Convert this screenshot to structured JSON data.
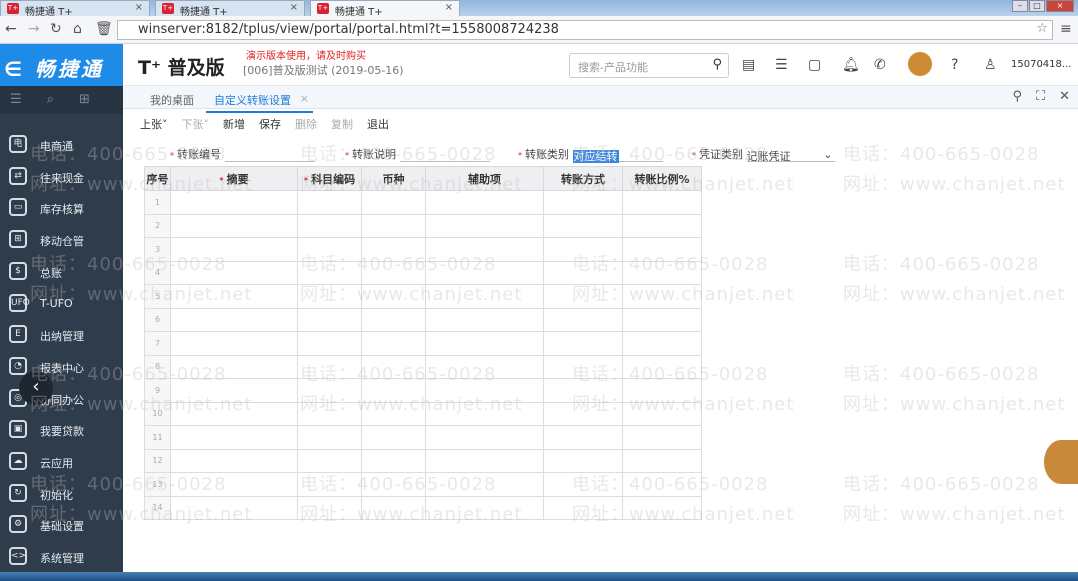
{
  "browser": {
    "tabs": [
      {
        "title": "畅捷通 T+"
      },
      {
        "title": "畅捷通 T+"
      },
      {
        "title": "畅捷通 T+"
      }
    ],
    "url": "winserver:8182/tplus/view/portal/portal.html?t=1558008724238"
  },
  "header": {
    "logo": "畅捷通",
    "brand": "T⁺ 普及版",
    "demo_notice": "演示版本使用，请及时购买",
    "account": "[006]普及版测试  (2019-05-16)",
    "search_placeholder": "搜索-产品功能",
    "user": "15070418..."
  },
  "sidebar": {
    "items": [
      {
        "label": "电商通",
        "icon": "电"
      },
      {
        "label": "往来现金",
        "icon": "⇄"
      },
      {
        "label": "库存核算",
        "icon": "▭"
      },
      {
        "label": "移动仓管",
        "icon": "⊞"
      },
      {
        "label": "总账",
        "icon": "$"
      },
      {
        "label": "T-UFO",
        "icon": "UFO"
      },
      {
        "label": "出纳管理",
        "icon": "E"
      },
      {
        "label": "报表中心",
        "icon": "◔"
      },
      {
        "label": "协同办公",
        "icon": "◎"
      },
      {
        "label": "我要贷款",
        "icon": "▣"
      },
      {
        "label": "云应用",
        "icon": "☁"
      },
      {
        "label": "初始化",
        "icon": "↻"
      },
      {
        "label": "基础设置",
        "icon": "⚙"
      },
      {
        "label": "系统管理",
        "icon": "<>"
      }
    ]
  },
  "page_tabs": [
    {
      "label": "我的桌面"
    },
    {
      "label": "自定义转账设置"
    }
  ],
  "toolbar": {
    "prev": "上张",
    "next": "下张",
    "new": "新增",
    "save": "保存",
    "delete": "删除",
    "copy": "复制",
    "exit": "退出"
  },
  "form": {
    "code_label": "转账编号",
    "code_value": "",
    "desc_label": "转账说明",
    "desc_value": "",
    "type_label": "转账类别",
    "type_value": "对应结转",
    "voucher_label": "凭证类别",
    "voucher_value": "记账凭证"
  },
  "table": {
    "headers": [
      "序号",
      "摘要",
      "科目编码",
      "币种",
      "辅助项",
      "转账方式",
      "转账比例%"
    ],
    "required": [
      false,
      true,
      true,
      false,
      false,
      false,
      false
    ],
    "rows": [
      "1",
      "2",
      "3",
      "4",
      "5",
      "6",
      "7",
      "8",
      "9",
      "10",
      "11",
      "12",
      "13",
      "14"
    ]
  },
  "watermark": {
    "phone": "电话：400-665-0028",
    "site": "网址：www.chanjet.net"
  }
}
